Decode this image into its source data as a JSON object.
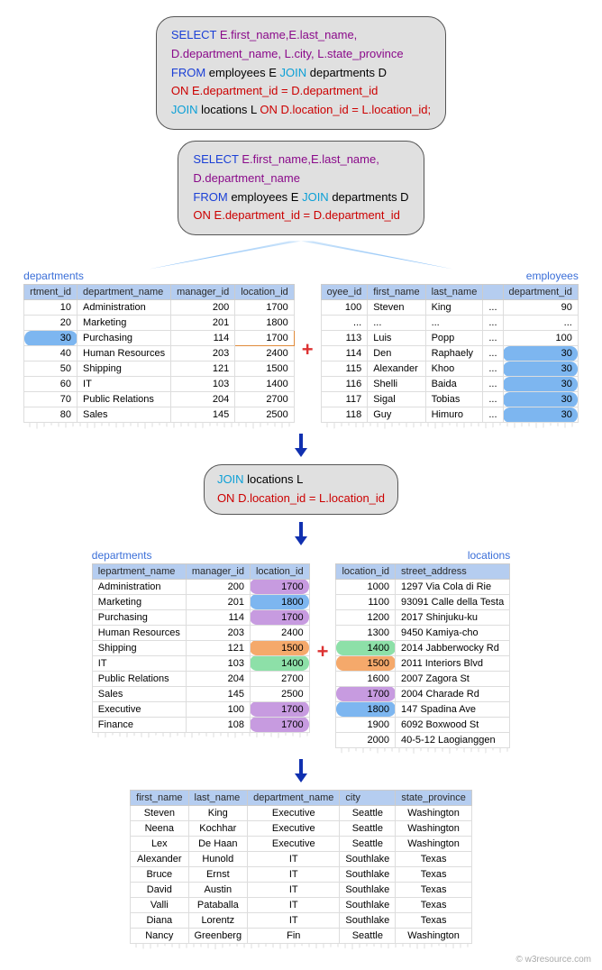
{
  "sql_box_1": {
    "l1a": "SELECT ",
    "l1b": "E.first_name,E.last_name,",
    "l2": "D.department_name, L.city, L.state_province",
    "l3a": "FROM ",
    "l3b": "employees E ",
    "l3c": "JOIN ",
    "l3d": "departments D",
    "l4a": "ON ",
    "l4b": "E.department_id = D.department_id",
    "l5a": "JOIN ",
    "l5b": "locations L ",
    "l5c": "ON ",
    "l5d": "D.location_id = L.location_id;"
  },
  "sql_box_2": {
    "l1a": "SELECT ",
    "l1b": "E.first_name,E.last_name,",
    "l2": "D.department_name",
    "l3a": "FROM ",
    "l3b": "employees E ",
    "l3c": "JOIN ",
    "l3d": "departments D",
    "l4a": "ON ",
    "l4b": "E.department_id = D.department_id"
  },
  "sql_box_3": {
    "l1a": "JOIN ",
    "l1b": "locations L",
    "l2a": "ON ",
    "l2b": "D.location_id = L.location_id"
  },
  "labels": {
    "departments": "departments",
    "employees": "employees",
    "locations": "locations"
  },
  "departments1": {
    "cols": [
      "rtment_id",
      "department_name",
      "manager_id",
      "location_id"
    ],
    "rows": [
      {
        "id": "10",
        "name": "Administration",
        "mgr": "200",
        "loc": "1700"
      },
      {
        "id": "20",
        "name": "Marketing",
        "mgr": "201",
        "loc": "1800"
      },
      {
        "id": "30",
        "name": "Purchasing",
        "mgr": "114",
        "loc": "1700",
        "hl_id": "blue",
        "hl_loc": "outline"
      },
      {
        "id": "40",
        "name": "Human Resources",
        "mgr": "203",
        "loc": "2400"
      },
      {
        "id": "50",
        "name": "Shipping",
        "mgr": "121",
        "loc": "1500"
      },
      {
        "id": "60",
        "name": "IT",
        "mgr": "103",
        "loc": "1400"
      },
      {
        "id": "70",
        "name": "Public Relations",
        "mgr": "204",
        "loc": "2700"
      },
      {
        "id": "80",
        "name": "Sales",
        "mgr": "145",
        "loc": "2500"
      }
    ]
  },
  "employees1": {
    "cols": [
      "oyee_id",
      "first_name",
      "last_name",
      "",
      "department_id"
    ],
    "rows": [
      {
        "id": "100",
        "fn": "Steven",
        "ln": "King",
        "d": "...",
        "dept": "90"
      },
      {
        "id": "...",
        "fn": "...",
        "ln": "...",
        "d": "...",
        "dept": "..."
      },
      {
        "id": "113",
        "fn": "Luis",
        "ln": "Popp",
        "d": "...",
        "dept": "100"
      },
      {
        "id": "114",
        "fn": "Den",
        "ln": "Raphaely",
        "d": "...",
        "dept": "30",
        "hl": "blue"
      },
      {
        "id": "115",
        "fn": "Alexander",
        "ln": "Khoo",
        "d": "...",
        "dept": "30",
        "hl": "blue"
      },
      {
        "id": "116",
        "fn": "Shelli",
        "ln": "Baida",
        "d": "...",
        "dept": "30",
        "hl": "blue"
      },
      {
        "id": "117",
        "fn": "Sigal",
        "ln": "Tobias",
        "d": "...",
        "dept": "30",
        "hl": "blue"
      },
      {
        "id": "118",
        "fn": "Guy",
        "ln": "Himuro",
        "d": "...",
        "dept": "30",
        "hl": "blue"
      }
    ]
  },
  "departments2": {
    "cols": [
      "lepartment_name",
      "manager_id",
      "location_id"
    ],
    "rows": [
      {
        "name": "Administration",
        "mgr": "200",
        "loc": "1700",
        "hl": "purple"
      },
      {
        "name": "Marketing",
        "mgr": "201",
        "loc": "1800",
        "hl": "blue"
      },
      {
        "name": "Purchasing",
        "mgr": "114",
        "loc": "1700",
        "hl": "purple"
      },
      {
        "name": "Human Resources",
        "mgr": "203",
        "loc": "2400"
      },
      {
        "name": "Shipping",
        "mgr": "121",
        "loc": "1500",
        "hl": "orange"
      },
      {
        "name": "IT",
        "mgr": "103",
        "loc": "1400",
        "hl": "green"
      },
      {
        "name": "Public Relations",
        "mgr": "204",
        "loc": "2700"
      },
      {
        "name": "Sales",
        "mgr": "145",
        "loc": "2500"
      },
      {
        "name": "Executive",
        "mgr": "100",
        "loc": "1700",
        "hl": "purple"
      },
      {
        "name": "Finance",
        "mgr": "108",
        "loc": "1700",
        "hl": "purple"
      }
    ]
  },
  "locations": {
    "cols": [
      "location_id",
      "street_address"
    ],
    "rows": [
      {
        "id": "1000",
        "addr": "1297 Via Cola di Rie"
      },
      {
        "id": "1100",
        "addr": "93091 Calle della Testa"
      },
      {
        "id": "1200",
        "addr": "2017 Shinjuku-ku"
      },
      {
        "id": "1300",
        "addr": "9450 Kamiya-cho"
      },
      {
        "id": "1400",
        "addr": "2014 Jabberwocky Rd",
        "hl": "green"
      },
      {
        "id": "1500",
        "addr": "2011 Interiors Blvd",
        "hl": "orange"
      },
      {
        "id": "1600",
        "addr": "2007 Zagora St"
      },
      {
        "id": "1700",
        "addr": "2004 Charade Rd",
        "hl": "purple"
      },
      {
        "id": "1800",
        "addr": "147 Spadina Ave",
        "hl": "blue"
      },
      {
        "id": "1900",
        "addr": "6092 Boxwood St"
      },
      {
        "id": "2000",
        "addr": "40-5-12 Laogianggen"
      }
    ]
  },
  "result": {
    "cols": [
      "first_name",
      "last_name",
      "department_name",
      "city",
      "state_province"
    ],
    "rows": [
      {
        "fn": "Steven",
        "ln": "King",
        "dept": "Executive",
        "city": "Seattle",
        "st": "Washington"
      },
      {
        "fn": "Neena",
        "ln": "Kochhar",
        "dept": "Executive",
        "city": "Seattle",
        "st": "Washington"
      },
      {
        "fn": "Lex",
        "ln": "De Haan",
        "dept": "Executive",
        "city": "Seattle",
        "st": "Washington"
      },
      {
        "fn": "Alexander",
        "ln": "Hunold",
        "dept": "IT",
        "city": "Southlake",
        "st": "Texas"
      },
      {
        "fn": "Bruce",
        "ln": "Ernst",
        "dept": "IT",
        "city": "Southlake",
        "st": "Texas"
      },
      {
        "fn": "David",
        "ln": "Austin",
        "dept": "IT",
        "city": "Southlake",
        "st": "Texas"
      },
      {
        "fn": "Valli",
        "ln": "Pataballa",
        "dept": "IT",
        "city": "Southlake",
        "st": "Texas"
      },
      {
        "fn": "Diana",
        "ln": "Lorentz",
        "dept": "IT",
        "city": "Southlake",
        "st": "Texas"
      },
      {
        "fn": "Nancy",
        "ln": "Greenberg",
        "dept": "Fin",
        "city": "Seattle",
        "st": "Washington"
      }
    ]
  },
  "watermark": "© w3resource.com"
}
